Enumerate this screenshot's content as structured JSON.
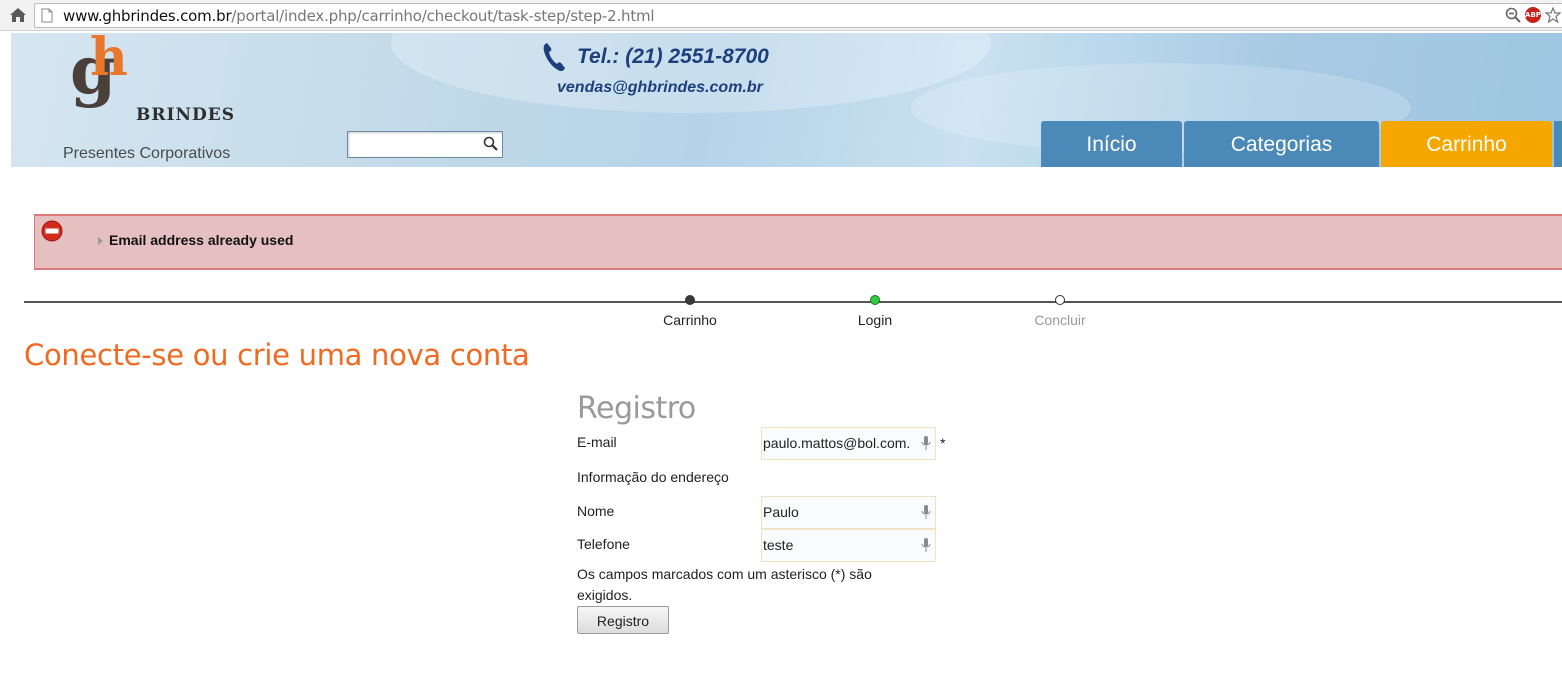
{
  "browser": {
    "url_host": "www.ghbrindes.com.br",
    "url_path": "/portal/index.php/carrinho/checkout/task-step/step-2.html",
    "abp_label": "ABP"
  },
  "header": {
    "logo_letters": "gh",
    "logo_brand": "BRINDES",
    "logo_tagline": "Presentes Corporativos",
    "phone": "Tel.: (21) 2551-8700",
    "email": "vendas@ghbrindes.com.br",
    "search_placeholder": ""
  },
  "nav": {
    "tabs": [
      {
        "label": "Início",
        "active": false
      },
      {
        "label": "Categorias",
        "active": false
      },
      {
        "label": "Carrinho",
        "active": true
      }
    ]
  },
  "error": {
    "message": "Email address already used"
  },
  "steps": [
    {
      "label": "Carrinho",
      "state": "done"
    },
    {
      "label": "Login",
      "state": "current"
    },
    {
      "label": "Concluir",
      "state": "pending"
    }
  ],
  "page": {
    "title": "Conecte-se ou crie uma nova conta"
  },
  "form": {
    "title": "Registro",
    "email_label": "E-mail",
    "email_value": "paulo.mattos@bol.com.",
    "required_mark": "*",
    "address_section_label": "Informação do endereço",
    "nome_label": "Nome",
    "nome_value": "Paulo",
    "telefone_label": "Telefone",
    "telefone_value": "teste",
    "required_note": "Os campos marcados com um asterisco (*) são exigidos.",
    "submit_label": "Registro"
  },
  "colors": {
    "accent_orange": "#f26a21",
    "nav_blue": "#4a89b8",
    "nav_active": "#f5a700",
    "error_bg": "#e6c0c0",
    "brand_blue": "#1d3f7c"
  }
}
